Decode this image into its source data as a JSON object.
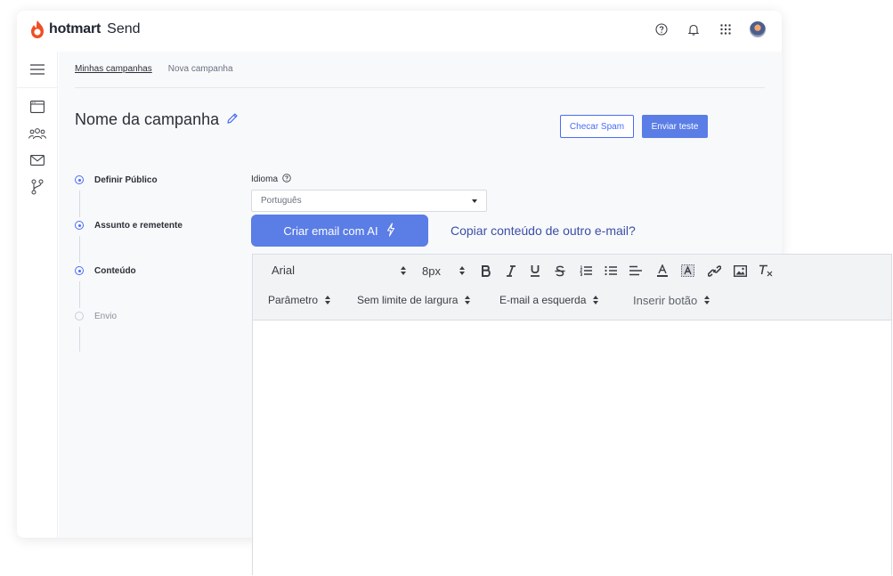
{
  "app": {
    "brand": "hotmart",
    "product": "Send"
  },
  "colors": {
    "accent": "#4a6cf7",
    "primary_button": "#5a7de6",
    "brand_flame": "#f04e23"
  },
  "breadcrumb": {
    "parent": "Minhas campanhas",
    "current": "Nova campanha"
  },
  "campaign": {
    "title": "Nome da campanha"
  },
  "actions": {
    "spam_check": "Checar Spam",
    "send_test": "Enviar teste"
  },
  "steps": [
    {
      "label": "Definir Público",
      "state": "active"
    },
    {
      "label": "Assunto e remetente",
      "state": "active"
    },
    {
      "label": "Conteúdo",
      "state": "active"
    },
    {
      "label": "Envio",
      "state": "inactive"
    }
  ],
  "language": {
    "label": "Idioma",
    "selected": "Português"
  },
  "content": {
    "ai_button": "Criar email com AI",
    "copy_link": "Copiar conteúdo de outro e-mail?"
  },
  "editor": {
    "font": "Arial",
    "size": "8px",
    "parameter": "Parâmetro",
    "width": "Sem limite de largura",
    "alignment": "E-mail a esquerda",
    "insert_button": "Inserir botão"
  },
  "icons": {
    "help": "help-circle-icon",
    "notifications": "bell-icon",
    "apps": "grid-icon",
    "menu": "hamburger-icon",
    "campaigns": "browser-window-icon",
    "audience": "users-icon",
    "mail": "envelope-icon",
    "flows": "git-branch-icon",
    "edit": "pencil-icon",
    "ai": "lightning-icon"
  }
}
